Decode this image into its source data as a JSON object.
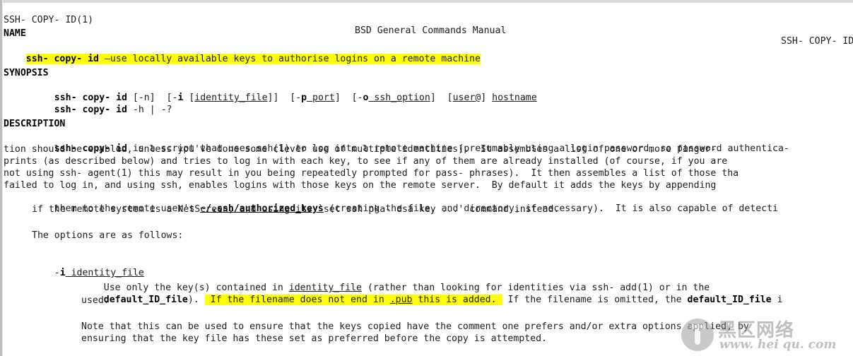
{
  "page": {
    "title": "SSH-COPY-ID(1) BSD General Commands Manual",
    "background": "#ffffff",
    "text_color": "#1d1d1d",
    "highlight_color": "#ffff00"
  },
  "header": {
    "left": "SSH- COPY- ID(1)",
    "center": "BSD General Commands Manual",
    "right": "SSH- COPY- ID("
  },
  "sections": {
    "name": {
      "heading": "NAME",
      "command": "ssh- copy- id",
      "dash": " —",
      "description": "use locally available keys to authorise logins on a remote machine"
    },
    "synopsis": {
      "heading": "SYNOPSIS",
      "line1": {
        "cmd": "ssh- copy- id",
        "opt_n": " [-n]  [-",
        "flag_i": "i",
        "bracket_open": " [",
        "identity_file": "identity_file",
        "bracket_close": "]]  [-",
        "flag_p": "p",
        "port": " port",
        "mid": "]  [-",
        "flag_o": "o",
        "ssh_option": " ssh_option",
        "tail": "]  [",
        "user": "user@",
        "tail2": "] ",
        "hostname": "hostname"
      },
      "line2": {
        "cmd": "ssh- copy- id",
        "rest": " -h | -?"
      }
    },
    "description": {
      "heading": "DESCRIPTION",
      "para1_cmd": "ssh- copy- id",
      "para1_lines": [
        " is a script that uses ssh(1) to log into a remote machine (presumably using a login password, so password authentica-",
        "tion should be enabled, unless you've done some clever use of multiple identities).  It assembles a list of one or more finger-",
        "prints (as described below) and tries to log in with each key, to see if any of them are already installed (of course, if you are",
        "not using ssh- agent(1) this may result in you being repeatedly prompted for pass- phrases).  It then assembles a list of those tha",
        "failed to log in, and using ssh, enables logins with those keys on the remote server.  By default it adds the keys by appending"
      ],
      "para1_line6_pre": "them to the remote user's ",
      "para1_line6_path": "~/.ssh/authorized_keys",
      "para1_line6_post": " (creating the file, and directory, if necessary).  It is also capable of detecti",
      "para1_line7": "if the remote system is a NetScreen, and using its `set ssh pka- dsa key ...' command instead.",
      "options_intro": "The options are as follows:",
      "opt_i": {
        "flag_dash": "-",
        "flag": "i",
        "arg": " identity_file",
        "body_line1_pre": "Use only the key(s) contained in ",
        "body_line1_arg": "identity_file",
        "body_line1_post": " (rather than looking for identities via ssh- add(1) or in the",
        "body_line2_bold": "default_ID_file",
        "body_line2_mid": "). ",
        "body_line2_hl_pre": " If the filename does not end in ",
        "body_line2_hl_pub": ".pub",
        "body_line2_hl_post": " this is added. ",
        "body_line2_tail": " If the filename is omitted, the ",
        "body_line2_bold2": "default_ID_file",
        "body_line2_end": " i",
        "body_line3": "used."
      },
      "note_line1": "Note that this can be used to ensure that the keys copied have the comment one prefers and/or extra options applied, by",
      "note_line2": "ensuring that the key file has these set as preferred before the copy is attempted."
    }
  },
  "watermark": {
    "cn_text": "黑区网络",
    "url_text": "www. hei qu. com",
    "logo": "circle-mushroom-logo"
  }
}
